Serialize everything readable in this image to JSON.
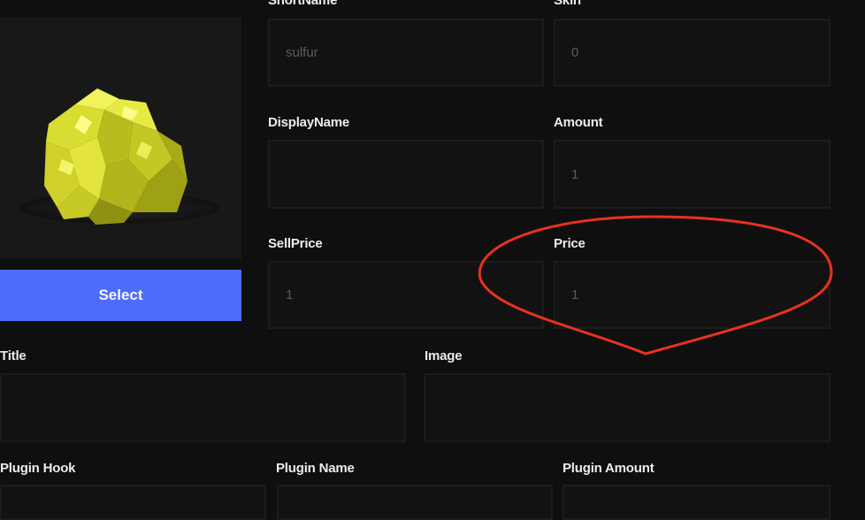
{
  "item": {
    "image_alt": "sulfur ore",
    "select_label": "Select"
  },
  "fields": {
    "shortname": {
      "label": "ShortName",
      "value": "sulfur"
    },
    "skin": {
      "label": "Skin",
      "value": "0"
    },
    "displayname": {
      "label": "DisplayName",
      "value": ""
    },
    "amount": {
      "label": "Amount",
      "value": "1"
    },
    "sellprice": {
      "label": "SellPrice",
      "value": "1"
    },
    "price": {
      "label": "Price",
      "value": "1"
    },
    "title": {
      "label": "Title",
      "value": ""
    },
    "image": {
      "label": "Image",
      "value": ""
    },
    "plugin_hook": {
      "label": "Plugin Hook",
      "value": ""
    },
    "plugin_name": {
      "label": "Plugin Name",
      "value": ""
    },
    "plugin_amount": {
      "label": "Plugin Amount",
      "value": ""
    }
  },
  "annotation": {
    "color": "#e8321e"
  },
  "colors": {
    "accent": "#4d6cfa",
    "background": "#0f0f0f",
    "field_bg": "#121212"
  }
}
